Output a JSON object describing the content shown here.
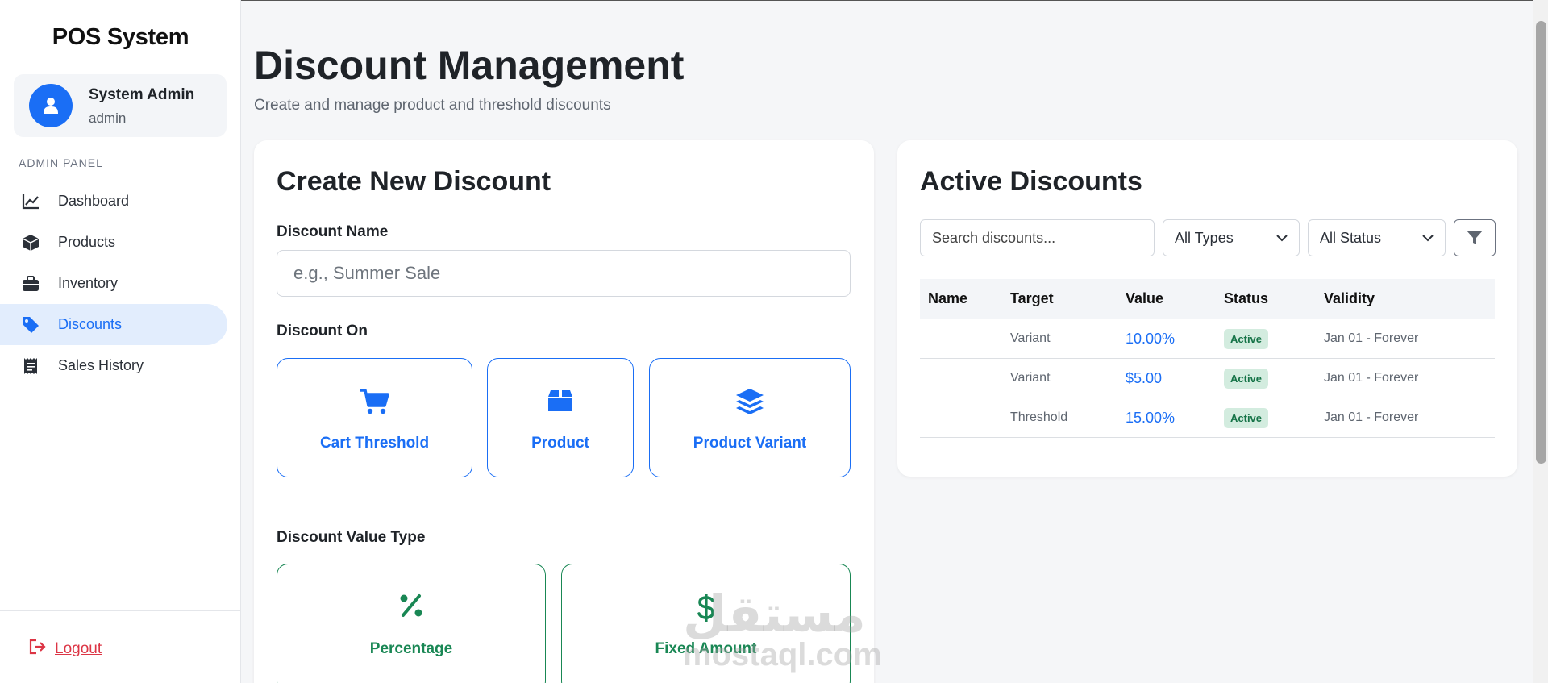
{
  "sidebar": {
    "brand": "POS System",
    "user": {
      "name": "System Admin",
      "role": "admin"
    },
    "section_label": "ADMIN PANEL",
    "items": [
      {
        "label": "Dashboard",
        "icon": "chart-line-icon"
      },
      {
        "label": "Products",
        "icon": "box-icon"
      },
      {
        "label": "Inventory",
        "icon": "briefcase-icon"
      },
      {
        "label": "Discounts",
        "icon": "tag-icon",
        "active": true
      },
      {
        "label": "Sales History",
        "icon": "receipt-icon"
      }
    ],
    "logout_label": "Logout"
  },
  "header": {
    "title": "Discount Management",
    "subtitle": "Create and manage product and threshold discounts"
  },
  "create_form": {
    "title": "Create New Discount",
    "name_label": "Discount Name",
    "name_placeholder": "e.g., Summer Sale",
    "discount_on_label": "Discount On",
    "discount_on_options": [
      "Cart Threshold",
      "Product",
      "Product Variant"
    ],
    "value_type_label": "Discount Value Type",
    "value_type_options": [
      "Percentage",
      "Fixed Amount"
    ]
  },
  "active_discounts": {
    "title": "Active Discounts",
    "search_placeholder": "Search discounts...",
    "type_filter": "All Types",
    "status_filter": "All Status",
    "columns": [
      "Name",
      "Target",
      "Value",
      "Status",
      "Validity"
    ],
    "rows": [
      {
        "name": "",
        "target": "Variant",
        "value": "10.00%",
        "status": "Active",
        "validity": "Jan 01 - Forever"
      },
      {
        "name": "",
        "target": "Variant",
        "value": "$5.00",
        "status": "Active",
        "validity": "Jan 01 - Forever"
      },
      {
        "name": "",
        "target": "Threshold",
        "value": "15.00%",
        "status": "Active",
        "validity": "Jan 01 - Forever"
      }
    ]
  },
  "watermark": {
    "arabic": "مستقل",
    "latin": "mostaql.com"
  },
  "colors": {
    "accent": "#1a6ef5",
    "success": "#198754",
    "danger": "#dc3545",
    "active_nav_bg": "#e2edfd"
  }
}
